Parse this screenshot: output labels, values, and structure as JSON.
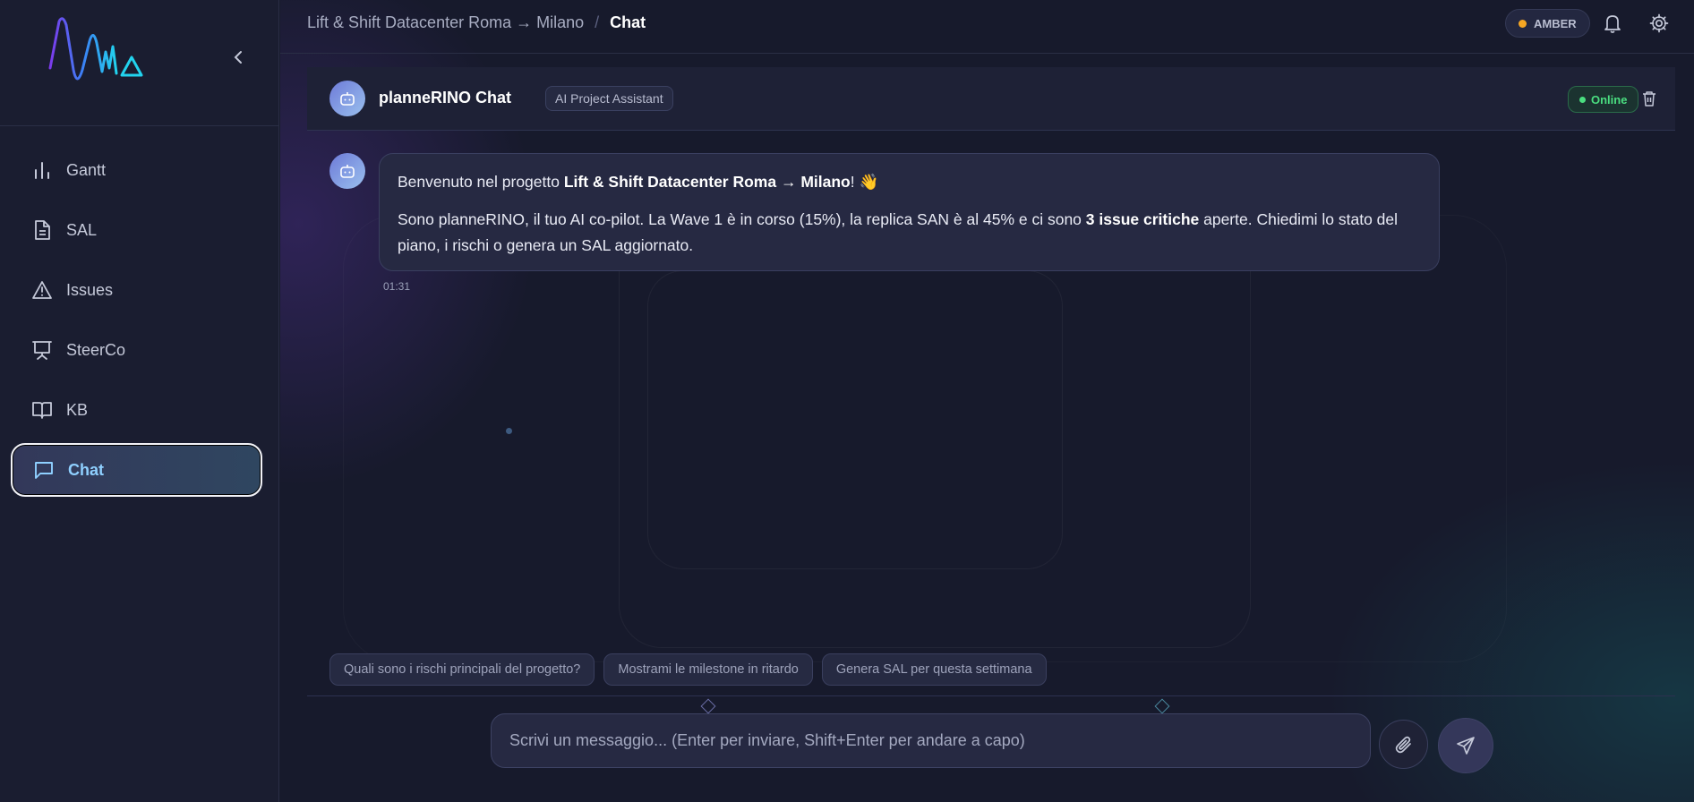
{
  "sidebar": {
    "collapse_label": "Collapse sidebar",
    "items": [
      {
        "label": "Gantt",
        "icon": "bar-chart-icon"
      },
      {
        "label": "SAL",
        "icon": "document-icon"
      },
      {
        "label": "Issues",
        "icon": "warning-icon"
      },
      {
        "label": "SteerCo",
        "icon": "presentation-icon"
      },
      {
        "label": "KB",
        "icon": "book-icon"
      },
      {
        "label": "Chat",
        "icon": "chat-icon",
        "active": true
      }
    ]
  },
  "header": {
    "breadcrumb_project": "Lift & Shift Datacenter Roma → Milano",
    "breadcrumb_sep": "/",
    "breadcrumb_current": "Chat",
    "status_label": "AMBER",
    "status_color": "#f5a623"
  },
  "chat": {
    "title": "planneRINO Chat",
    "role_badge": "AI Project Assistant",
    "online_label": "Online",
    "messages": [
      {
        "p1_prefix": "Benvenuto nel progetto ",
        "p1_project": "Lift & Shift Datacenter Roma → Milano",
        "p1_suffix": "!  👋",
        "p2_part1": "Sono planneRINO, il tuo AI co-pilot. La Wave 1 è in corso (15%), la replica SAN è al 45% e ci sono ",
        "p2_bold": "3 issue critiche",
        "p2_part2": " aperte. Chiedimi lo stato del piano, i rischi o genera un SAL aggiornato.",
        "time": "01:31"
      }
    ],
    "suggestions": [
      "Quali sono i rischi principali del progetto?",
      "Mostrami le milestone in ritardo",
      "Genera SAL per questa settimana"
    ],
    "composer_placeholder": "Scrivi un messaggio... (Enter per inviare, Shift+Enter per andare a capo)"
  }
}
